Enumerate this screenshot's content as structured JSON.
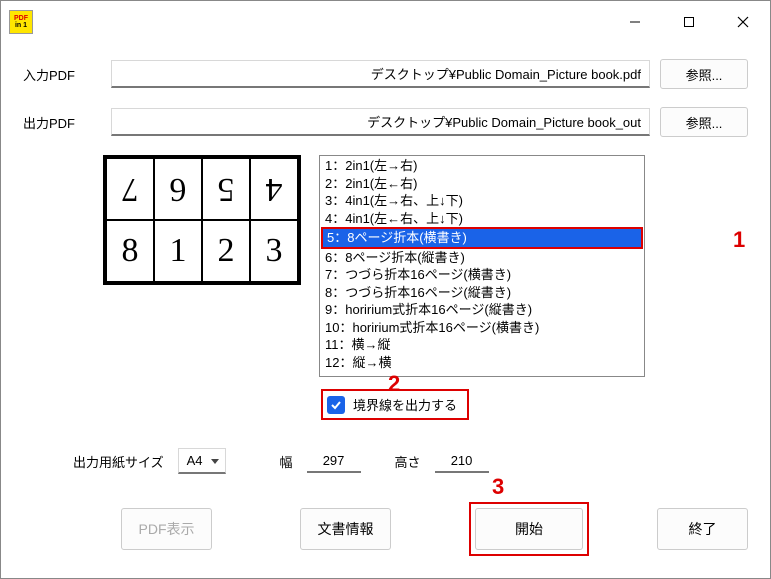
{
  "titlebar": {
    "icon": {
      "line1": "PDF",
      "line2": "in 1"
    }
  },
  "input": {
    "label": "入力PDF",
    "path": "デスクトップ¥Public Domain_Picture book.pdf",
    "browse": "参照..."
  },
  "output": {
    "label": "出力PDF",
    "path": "デスクトップ¥Public Domain_Picture book_out",
    "browse": "参照..."
  },
  "preview": {
    "row1": [
      "7",
      "6",
      "5",
      "4"
    ],
    "row2": [
      "8",
      "1",
      "2",
      "3"
    ]
  },
  "layouts": {
    "items": [
      "1：2in1(左→右)",
      "2：2in1(左←右)",
      "3：4in1(左→右、上↓下)",
      "4：4in1(左←右、上↓下)",
      "5：8ページ折本(横書き)",
      "6：8ページ折本(縦書き)",
      "7：つづら折本16ページ(横書き)",
      "8：つづら折本16ページ(縦書き)",
      "9：horirium式折本16ページ(縦書き)",
      "10：horirium式折本16ページ(横書き)",
      "11：横→縦",
      "12：縦→横"
    ],
    "selected_index": 4
  },
  "annotations": {
    "a1": "1",
    "a2": "2",
    "a3": "3"
  },
  "border_checkbox": {
    "label": "境界線を出力する",
    "checked": true
  },
  "paper": {
    "label": "出力用紙サイズ",
    "size": "A4",
    "width_label": "幅",
    "width": "297",
    "height_label": "高さ",
    "height": "210"
  },
  "buttons": {
    "preview_pdf": "PDF表示",
    "doc_info": "文書情報",
    "start": "開始",
    "exit": "終了"
  }
}
